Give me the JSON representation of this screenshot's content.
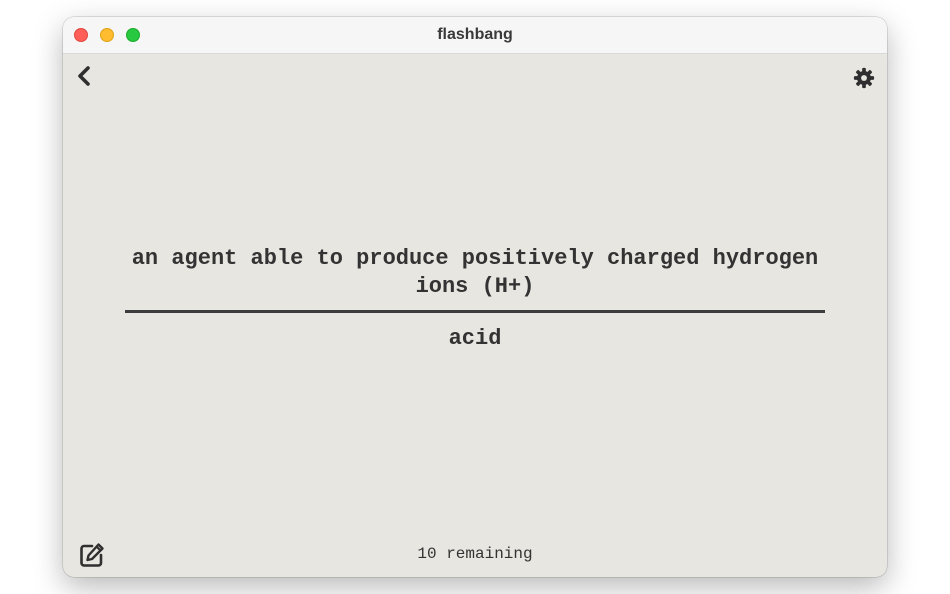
{
  "window": {
    "title": "flashbang"
  },
  "toolbar": {
    "back_icon": "chevron-left-icon",
    "settings_icon": "gear-icon",
    "edit_icon": "edit-icon"
  },
  "card": {
    "question": "an agent able to produce positively charged hydrogen ions (H+)",
    "answer": "acid"
  },
  "footer": {
    "remaining_text": "10 remaining"
  },
  "colors": {
    "window_bg": "#e8e6e1",
    "text": "#333333",
    "close": "#ff5f57",
    "minimize": "#febc2e",
    "zoom": "#28c840"
  }
}
